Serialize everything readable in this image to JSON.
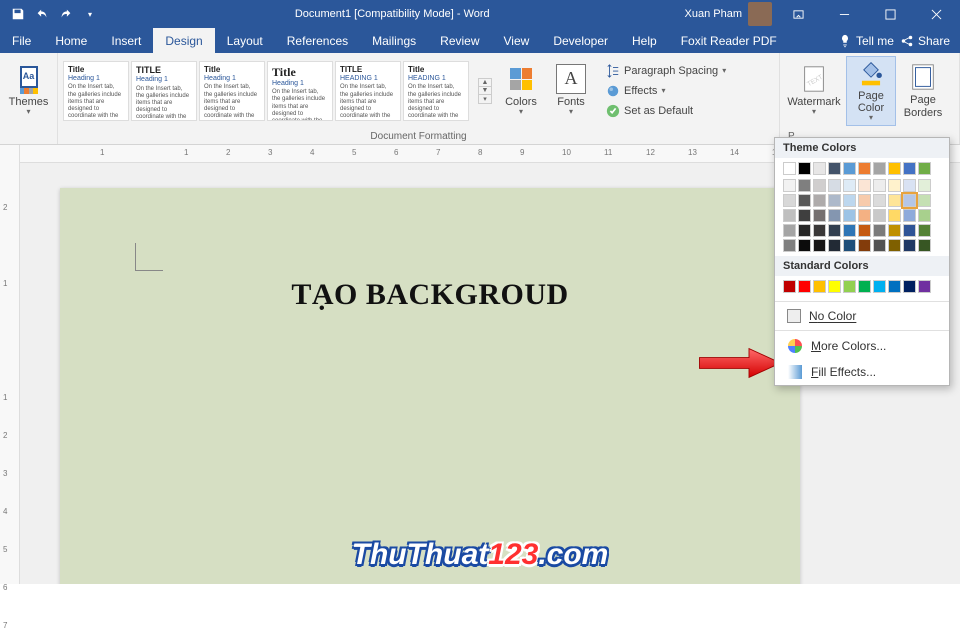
{
  "titlebar": {
    "title": "Document1 [Compatibility Mode] - Word",
    "username": "Xuan Pham"
  },
  "tabs": {
    "file": "File",
    "list": [
      "Home",
      "Insert",
      "Design",
      "Layout",
      "References",
      "Mailings",
      "Review",
      "View",
      "Developer",
      "Help",
      "Foxit Reader PDF"
    ],
    "active_index": 2,
    "tell_me": "Tell me",
    "share": "Share"
  },
  "ribbon": {
    "themes": {
      "label": "Themes"
    },
    "doc_formatting": {
      "label": "Document Formatting",
      "styles": [
        {
          "title": "Title",
          "heading": "Heading 1",
          "body": "On the Insert tab, the galleries include items that are designed to coordinate with the overall look"
        },
        {
          "title": "TITLE",
          "heading": "Heading 1",
          "body": "On the Insert tab, the galleries include items that are designed to coordinate with the overall look"
        },
        {
          "title": "Title",
          "heading": "Heading 1",
          "body": "On the Insert tab, the galleries include items that are designed to coordinate with the overall look"
        },
        {
          "title": "Title",
          "heading": "Heading 1",
          "body": "On the Insert tab, the galleries include items that are designed to coordinate with the overall look"
        },
        {
          "title": "TITLE",
          "heading": "HEADING 1",
          "body": "On the Insert tab, the galleries include items that are designed to coordinate with the overall look"
        },
        {
          "title": "Title",
          "heading": "HEADING 1",
          "body": "On the Insert tab, the galleries include items that are designed to coordinate with the overall look"
        }
      ],
      "colors_label": "Colors",
      "fonts_label": "Fonts",
      "para_spacing": "Paragraph Spacing",
      "effects": "Effects",
      "set_default": "Set as Default"
    },
    "page_bg": {
      "group_label": "Page Background",
      "watermark": "Watermark",
      "page_color": "Page Color",
      "page_borders": "Page Borders"
    }
  },
  "color_popup": {
    "theme_label": "Theme Colors",
    "standard_label": "Standard Colors",
    "no_color": "No Color",
    "more_colors": "More Colors...",
    "fill_effects": "Fill Effects...",
    "theme_row1": [
      "#ffffff",
      "#000000",
      "#e7e6e6",
      "#44546a",
      "#5b9bd5",
      "#ed7d31",
      "#a5a5a5",
      "#ffc000",
      "#4472c4",
      "#70ad47"
    ],
    "theme_shades": [
      [
        "#f2f2f2",
        "#7f7f7f",
        "#d0cece",
        "#d6dce4",
        "#deebf6",
        "#fbe5d5",
        "#ededed",
        "#fff2cc",
        "#d9e2f3",
        "#e2efd9"
      ],
      [
        "#d8d8d8",
        "#595959",
        "#aeabab",
        "#adb9ca",
        "#bdd7ee",
        "#f7cbac",
        "#dbdbdb",
        "#fee599",
        "#b4c6e7",
        "#c5e0b3"
      ],
      [
        "#bfbfbf",
        "#3f3f3f",
        "#757070",
        "#8496b0",
        "#9cc3e5",
        "#f4b183",
        "#c9c9c9",
        "#ffd965",
        "#8eaadb",
        "#a8d08d"
      ],
      [
        "#a5a5a5",
        "#262626",
        "#3a3838",
        "#323f4f",
        "#2e75b5",
        "#c55a11",
        "#7b7b7b",
        "#bf9000",
        "#2f5496",
        "#538135"
      ],
      [
        "#7f7f7f",
        "#0c0c0c",
        "#171616",
        "#222a35",
        "#1e4e79",
        "#833c0b",
        "#525252",
        "#7f6000",
        "#1f3864",
        "#375623"
      ]
    ],
    "selected": [
      1,
      8
    ],
    "standard_row": [
      "#c00000",
      "#ff0000",
      "#ffc000",
      "#ffff00",
      "#92d050",
      "#00b050",
      "#00b0f0",
      "#0070c0",
      "#002060",
      "#7030a0"
    ]
  },
  "document": {
    "headline": "TẠO BACKGROUD",
    "page_bg_color": "#d6dfc3"
  },
  "ruler": {
    "h_marks": [
      "1",
      "",
      "1",
      "2",
      "3",
      "4",
      "5",
      "6",
      "7",
      "8",
      "9",
      "10",
      "11",
      "12",
      "13",
      "14",
      "15"
    ],
    "v_marks": [
      "",
      "2",
      "",
      "1",
      "",
      "",
      "1",
      "2",
      "3",
      "4",
      "5",
      "6",
      "7"
    ]
  },
  "branding": {
    "p1": "ThuThuat",
    "p2": "123",
    "p3": ".com"
  }
}
